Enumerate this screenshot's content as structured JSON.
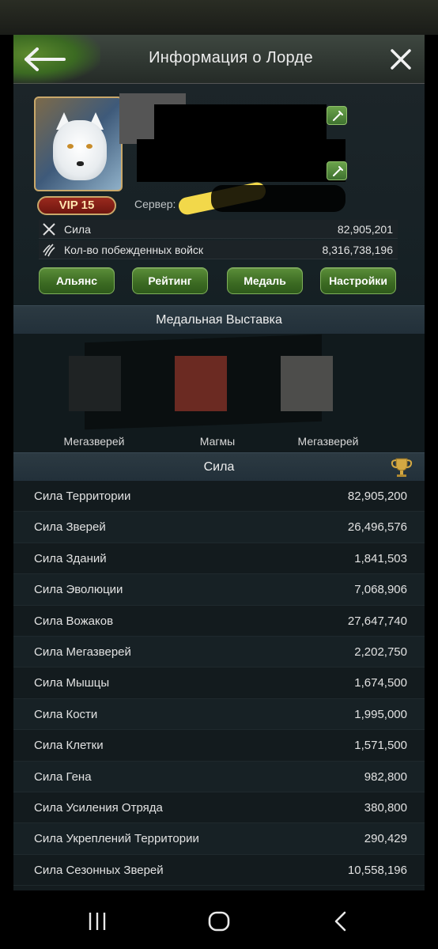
{
  "header": {
    "title": "Информация о Лорде"
  },
  "profile": {
    "vip": "VIP 15",
    "server_label": "Сервер:",
    "stats": [
      {
        "icon": "crossed-swords-icon",
        "label": "Сила",
        "value": "82,905,201"
      },
      {
        "icon": "claw-marks-icon",
        "label": "Кол-во побежденных войск",
        "value": "8,316,738,196"
      }
    ],
    "buttons": {
      "alliance": "Альянс",
      "rating": "Рейтинг",
      "medal": "Медаль",
      "settings": "Настройки"
    }
  },
  "medals": {
    "title": "Медальная Выставка",
    "items": [
      {
        "label": "Мегазверей",
        "color": "#1f2324"
      },
      {
        "label": "Магмы",
        "color": "#6b2a22"
      },
      {
        "label": "Мегазверей",
        "color": "#4d4d4b"
      }
    ]
  },
  "power": {
    "title": "Сила",
    "rows": [
      {
        "label": "Сила Территории",
        "value": "82,905,200"
      },
      {
        "label": "Сила Зверей",
        "value": "26,496,576"
      },
      {
        "label": "Сила Зданий",
        "value": "1,841,503"
      },
      {
        "label": "Сила Эволюции",
        "value": "7,068,906"
      },
      {
        "label": "Сила Вожаков",
        "value": "27,647,740"
      },
      {
        "label": "Сила Мегазверей",
        "value": "2,202,750"
      },
      {
        "label": "Сила Мышцы",
        "value": "1,674,500"
      },
      {
        "label": "Сила Кости",
        "value": "1,995,000"
      },
      {
        "label": "Сила Клетки",
        "value": "1,571,500"
      },
      {
        "label": "Сила Гена",
        "value": "982,800"
      },
      {
        "label": "Сила Усиления Отряда",
        "value": "380,800"
      },
      {
        "label": "Сила Укреплений Территории",
        "value": "290,429"
      },
      {
        "label": "Сила Сезонных Зверей",
        "value": "10,558,196"
      }
    ]
  },
  "colors": {
    "accent_green": "#4b7d2d",
    "vip_red": "#8a2418",
    "gold": "#c9a86a"
  }
}
